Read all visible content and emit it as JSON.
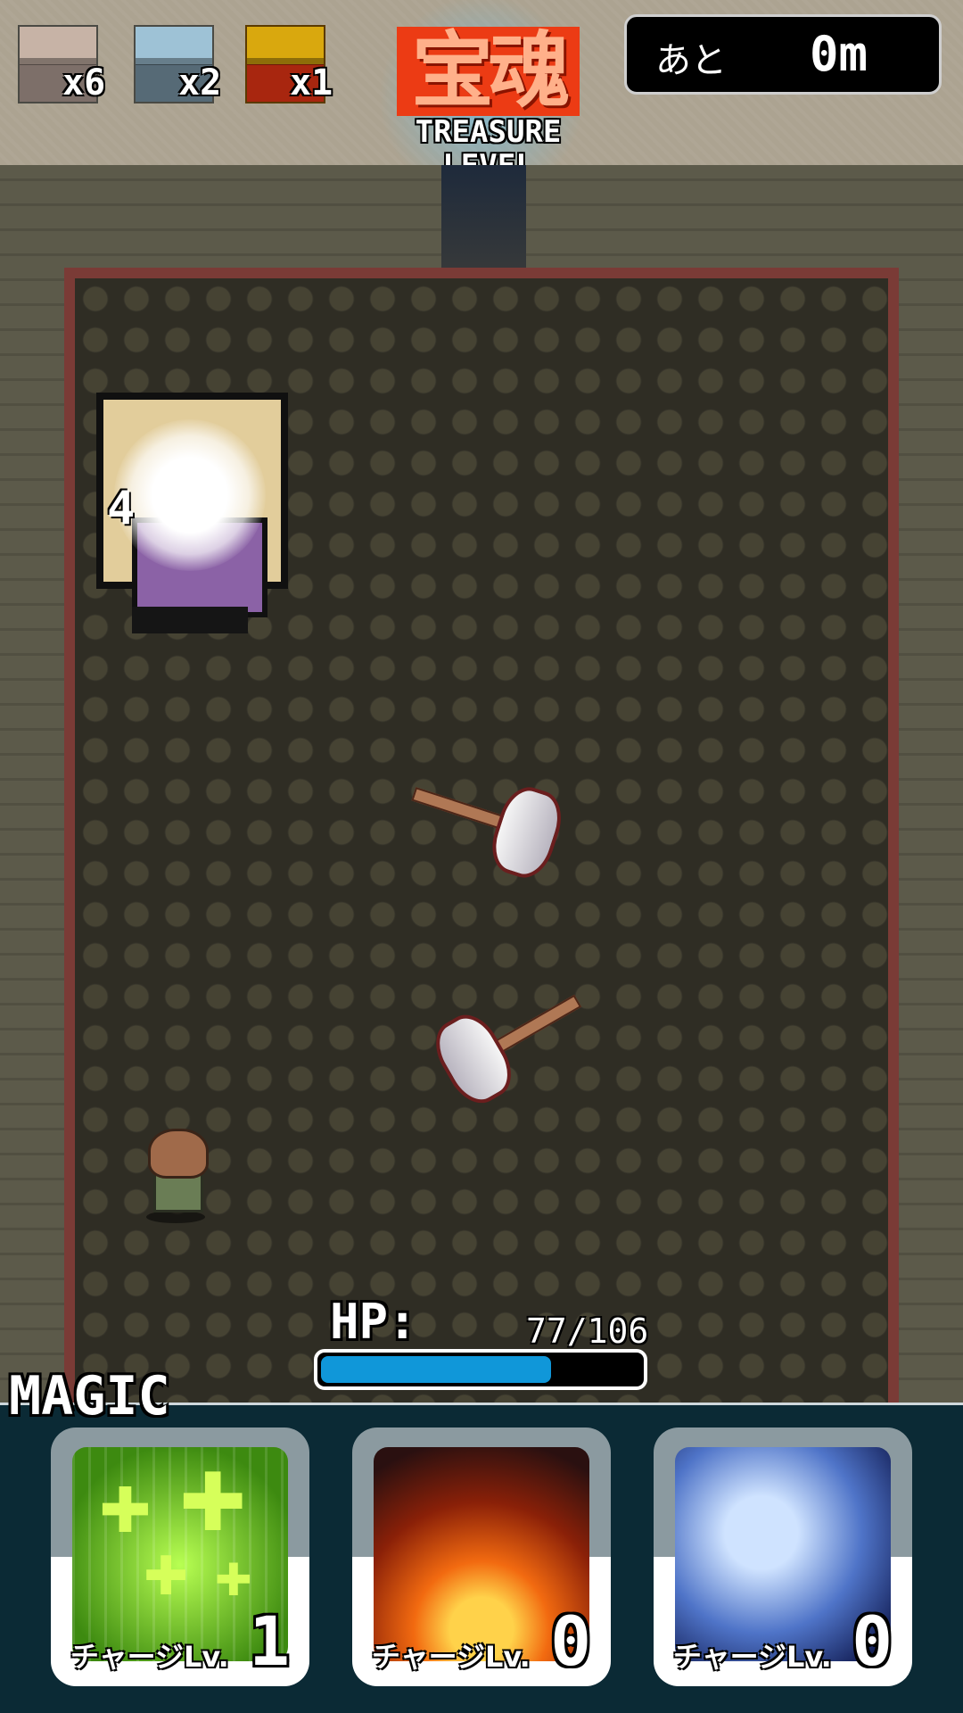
{
  "hud": {
    "chests": [
      {
        "type": "wood",
        "count": "x6"
      },
      {
        "type": "iron",
        "count": "x2"
      },
      {
        "type": "gold",
        "count": "x1"
      }
    ],
    "logo": {
      "kanji": "宝魂",
      "line1": "TREASURE",
      "line2": "LEVEL"
    },
    "distance": {
      "label": "あと",
      "value": "0m"
    }
  },
  "battle": {
    "damage_number": "4",
    "enemy_icon": "ghost-enemy-icon",
    "projectile_icon": "axe-icon"
  },
  "player": {
    "hp_label": "HP:",
    "hp_value": "77/106",
    "hp_current": 77,
    "hp_max": 106,
    "hp_color": "#1097d9"
  },
  "magic": {
    "title": "MAGIC",
    "cards": [
      {
        "name": "heal",
        "caption": "チャージLv.",
        "level": "1"
      },
      {
        "name": "fire",
        "caption": "チャージLv.",
        "level": "0"
      },
      {
        "name": "slash",
        "caption": "チャージLv.",
        "level": "0"
      }
    ]
  }
}
